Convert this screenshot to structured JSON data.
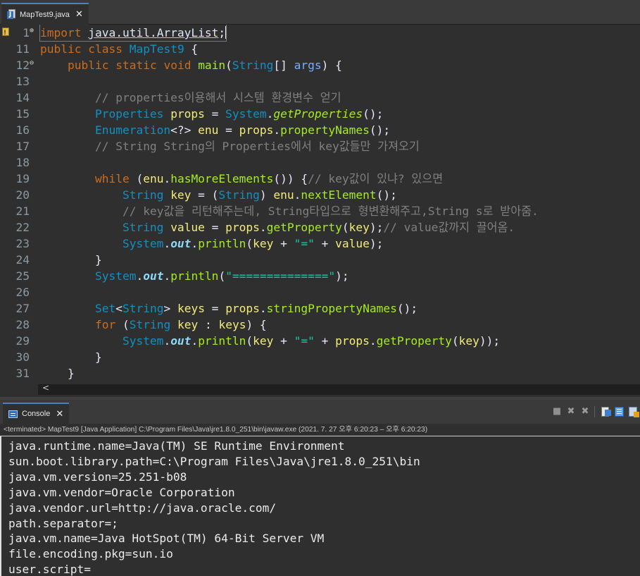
{
  "editor_tab": {
    "label": "MapTest9.java",
    "close": "✕"
  },
  "lines": [
    {
      "n": "1",
      "fold": "⊕",
      "tokens": [
        [
          "kw",
          "import"
        ],
        [
          "op",
          " "
        ],
        [
          "ul",
          "java.util.ArrayList"
        ],
        [
          "op",
          ";"
        ]
      ],
      "caret": true
    },
    {
      "n": "11",
      "fold": "",
      "tokens": [
        [
          "kw",
          "public"
        ],
        [
          "op",
          " "
        ],
        [
          "kw",
          "class"
        ],
        [
          "op",
          " "
        ],
        [
          "ty",
          "MapTest9"
        ],
        [
          "op",
          " {"
        ]
      ]
    },
    {
      "n": "12",
      "fold": "⊖",
      "tokens": [
        [
          "op",
          "    "
        ],
        [
          "kw",
          "public"
        ],
        [
          "op",
          " "
        ],
        [
          "kw",
          "static"
        ],
        [
          "op",
          " "
        ],
        [
          "kw",
          "void"
        ],
        [
          "op",
          " "
        ],
        [
          "fn",
          "main"
        ],
        [
          "op",
          "("
        ],
        [
          "ty",
          "String"
        ],
        [
          "op",
          "[] "
        ],
        [
          "pm",
          "args"
        ],
        [
          "op",
          ") {"
        ]
      ]
    },
    {
      "n": "13",
      "fold": "",
      "tokens": []
    },
    {
      "n": "14",
      "fold": "",
      "tokens": [
        [
          "op",
          "        "
        ],
        [
          "cm",
          "// properties이용해서 시스템 환경변수 얻기"
        ]
      ]
    },
    {
      "n": "15",
      "fold": "",
      "tokens": [
        [
          "op",
          "        "
        ],
        [
          "ty",
          "Properties"
        ],
        [
          "op",
          " "
        ],
        [
          "vr",
          "props"
        ],
        [
          "op",
          " = "
        ],
        [
          "ty",
          "System"
        ],
        [
          "op",
          "."
        ],
        [
          "fni",
          "getProperties"
        ],
        [
          "op",
          "();"
        ]
      ]
    },
    {
      "n": "16",
      "fold": "",
      "tokens": [
        [
          "op",
          "        "
        ],
        [
          "ty",
          "Enumeration"
        ],
        [
          "op",
          "<?> "
        ],
        [
          "vr",
          "enu"
        ],
        [
          "op",
          " = "
        ],
        [
          "vr",
          "props"
        ],
        [
          "op",
          "."
        ],
        [
          "fn",
          "propertyNames"
        ],
        [
          "op",
          "();"
        ]
      ]
    },
    {
      "n": "17",
      "fold": "",
      "tokens": [
        [
          "op",
          "        "
        ],
        [
          "cm",
          "// String String의 Properties에서 key값들만 가져오기"
        ]
      ]
    },
    {
      "n": "18",
      "fold": "",
      "tokens": []
    },
    {
      "n": "19",
      "fold": "",
      "tokens": [
        [
          "op",
          "        "
        ],
        [
          "kw",
          "while"
        ],
        [
          "op",
          " ("
        ],
        [
          "vr",
          "enu"
        ],
        [
          "op",
          "."
        ],
        [
          "fn",
          "hasMoreElements"
        ],
        [
          "op",
          "()) {"
        ],
        [
          "cm",
          "// key값이 있냐? 있으면"
        ]
      ]
    },
    {
      "n": "20",
      "fold": "",
      "tokens": [
        [
          "op",
          "            "
        ],
        [
          "ty",
          "String"
        ],
        [
          "op",
          " "
        ],
        [
          "vr",
          "key"
        ],
        [
          "op",
          " = ("
        ],
        [
          "ty",
          "String"
        ],
        [
          "op",
          ") "
        ],
        [
          "vr",
          "enu"
        ],
        [
          "op",
          "."
        ],
        [
          "fn",
          "nextElement"
        ],
        [
          "op",
          "();"
        ]
      ]
    },
    {
      "n": "21",
      "fold": "",
      "tokens": [
        [
          "op",
          "            "
        ],
        [
          "cm",
          "// key값을 리턴해주는데, String타입으로 형변환해주고,String s로 받아줌."
        ]
      ]
    },
    {
      "n": "22",
      "fold": "",
      "tokens": [
        [
          "op",
          "            "
        ],
        [
          "ty",
          "String"
        ],
        [
          "op",
          " "
        ],
        [
          "vr",
          "value"
        ],
        [
          "op",
          " = "
        ],
        [
          "vr",
          "props"
        ],
        [
          "op",
          "."
        ],
        [
          "fn",
          "getProperty"
        ],
        [
          "op",
          "("
        ],
        [
          "vr",
          "key"
        ],
        [
          "op",
          ");"
        ],
        [
          "cm",
          "// value값까지 끌어옴."
        ]
      ]
    },
    {
      "n": "23",
      "fold": "",
      "tokens": [
        [
          "op",
          "            "
        ],
        [
          "ty",
          "System"
        ],
        [
          "op",
          "."
        ],
        [
          "sf",
          "out"
        ],
        [
          "op",
          "."
        ],
        [
          "fn",
          "println"
        ],
        [
          "op",
          "("
        ],
        [
          "vr",
          "key"
        ],
        [
          "op",
          " + "
        ],
        [
          "st",
          "\"=\""
        ],
        [
          "op",
          " + "
        ],
        [
          "vr",
          "value"
        ],
        [
          "op",
          ");"
        ]
      ]
    },
    {
      "n": "24",
      "fold": "",
      "tokens": [
        [
          "op",
          "        }"
        ]
      ]
    },
    {
      "n": "25",
      "fold": "",
      "tokens": [
        [
          "op",
          "        "
        ],
        [
          "ty",
          "System"
        ],
        [
          "op",
          "."
        ],
        [
          "sf",
          "out"
        ],
        [
          "op",
          "."
        ],
        [
          "fn",
          "println"
        ],
        [
          "op",
          "("
        ],
        [
          "st",
          "\"==============\""
        ],
        [
          "op",
          ");"
        ]
      ]
    },
    {
      "n": "26",
      "fold": "",
      "tokens": []
    },
    {
      "n": "27",
      "fold": "",
      "tokens": [
        [
          "op",
          "        "
        ],
        [
          "ty",
          "Set"
        ],
        [
          "op",
          "<"
        ],
        [
          "ty",
          "String"
        ],
        [
          "op",
          "> "
        ],
        [
          "vr",
          "keys"
        ],
        [
          "op",
          " = "
        ],
        [
          "vr",
          "props"
        ],
        [
          "op",
          "."
        ],
        [
          "fn",
          "stringPropertyNames"
        ],
        [
          "op",
          "();"
        ]
      ]
    },
    {
      "n": "28",
      "fold": "",
      "tokens": [
        [
          "op",
          "        "
        ],
        [
          "kw",
          "for"
        ],
        [
          "op",
          " ("
        ],
        [
          "ty",
          "String"
        ],
        [
          "op",
          " "
        ],
        [
          "vr",
          "key"
        ],
        [
          "op",
          " : "
        ],
        [
          "vr",
          "keys"
        ],
        [
          "op",
          ") {"
        ]
      ]
    },
    {
      "n": "29",
      "fold": "",
      "tokens": [
        [
          "op",
          "            "
        ],
        [
          "ty",
          "System"
        ],
        [
          "op",
          "."
        ],
        [
          "sf",
          "out"
        ],
        [
          "op",
          "."
        ],
        [
          "fn",
          "println"
        ],
        [
          "op",
          "("
        ],
        [
          "vr",
          "key"
        ],
        [
          "op",
          " + "
        ],
        [
          "st",
          "\"=\""
        ],
        [
          "op",
          " + "
        ],
        [
          "vr",
          "props"
        ],
        [
          "op",
          "."
        ],
        [
          "fn",
          "getProperty"
        ],
        [
          "op",
          "("
        ],
        [
          "vr",
          "key"
        ],
        [
          "op",
          "));"
        ]
      ]
    },
    {
      "n": "30",
      "fold": "",
      "tokens": [
        [
          "op",
          "        }"
        ]
      ]
    },
    {
      "n": "31",
      "fold": "",
      "tokens": [
        [
          "op",
          "    }"
        ]
      ]
    }
  ],
  "scroll_left_arrow": "<",
  "console": {
    "tab_label": "Console",
    "close": "✕",
    "status": "<terminated> MapTest9 [Java Application] C:\\Program Files\\Java\\jre1.8.0_251\\bin\\javaw.exe  (2021. 7. 27 오후 6:20:23 – 오후 6:20:23)",
    "toolbar_glyphs": {
      "stop": "■",
      "remove": "✖",
      "remove_all": "✖"
    },
    "output": [
      "java.runtime.name=Java(TM) SE Runtime Environment",
      "sun.boot.library.path=C:\\Program Files\\Java\\jre1.8.0_251\\bin",
      "java.vm.version=25.251-b08",
      "java.vm.vendor=Oracle Corporation",
      "java.vendor.url=http://java.oracle.com/",
      "path.separator=;",
      "java.vm.name=Java HotSpot(TM) 64-Bit Server VM",
      "file.encoding.pkg=sun.io",
      "user.script="
    ]
  },
  "colors": {
    "keyword": "#cc6c1d",
    "type": "#1290c3",
    "method": "#a7ec21",
    "variable": "#f3ec79",
    "string": "#17c6a3",
    "comment": "#808080",
    "static_field": "#8dd9f8",
    "background": "#2f2f2f"
  }
}
